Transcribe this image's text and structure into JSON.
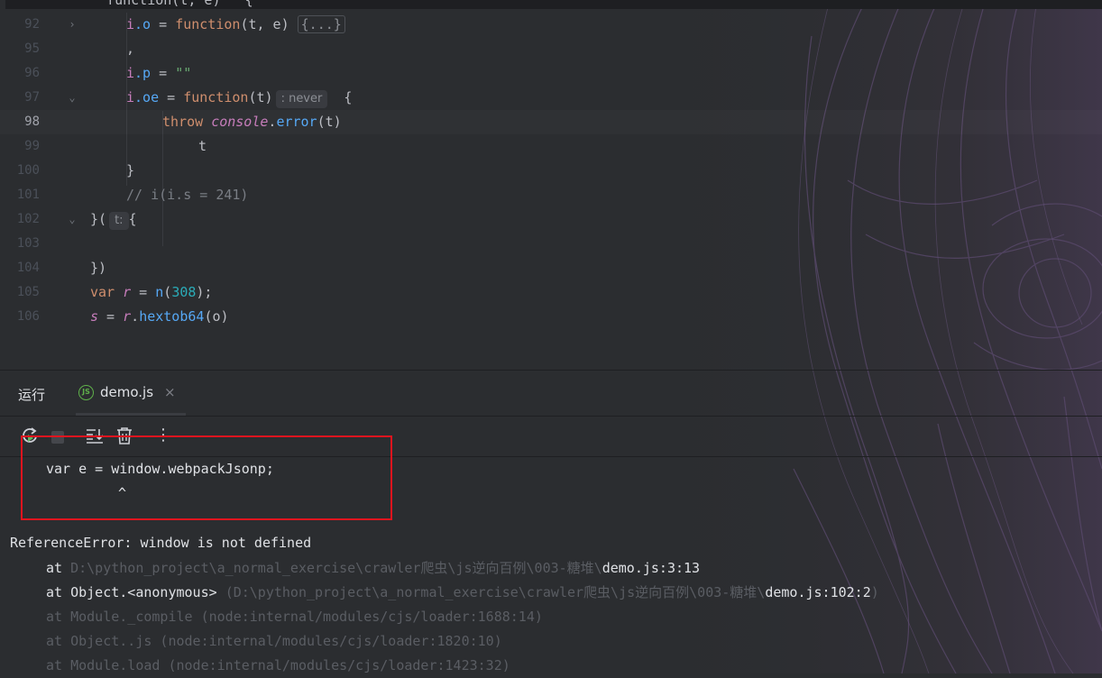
{
  "editor": {
    "top_partial_text": "  function(t, e)   {",
    "lines": [
      {
        "num": "92",
        "fold": "›",
        "code": [
          [
            "i",
            "prop"
          ],
          [
            ".o",
            "fn"
          ],
          [
            " = ",
            ""
          ],
          [
            "function",
            "kw"
          ],
          [
            "(t, e) ",
            ""
          ]
        ],
        "fold_box": "{...}"
      },
      {
        "num": "95",
        "code": [
          [
            ",",
            ""
          ]
        ]
      },
      {
        "num": "96",
        "code": [
          [
            "i",
            "prop"
          ],
          [
            ".p",
            "fn"
          ],
          [
            " = ",
            ""
          ],
          [
            "\"\"",
            "str"
          ]
        ]
      },
      {
        "num": "97",
        "fold": "⌄",
        "code": [
          [
            "i",
            "prop"
          ],
          [
            ".oe",
            "fn"
          ],
          [
            " = ",
            ""
          ],
          [
            "function",
            "kw"
          ],
          [
            "(t)",
            ""
          ]
        ],
        "hint": ": never",
        "after_hint": "  {"
      },
      {
        "num": "98",
        "current": true,
        "code": [
          [
            "throw ",
            "kw"
          ],
          [
            "console",
            "ital"
          ],
          [
            ".",
            ""
          ],
          [
            "error",
            "fn"
          ],
          [
            "(t)",
            ""
          ]
        ]
      },
      {
        "num": "99",
        "code": [
          [
            "t",
            ""
          ]
        ]
      },
      {
        "num": "100",
        "code": [
          [
            "}",
            ""
          ]
        ]
      },
      {
        "num": "101",
        "code": [
          [
            "// i(i.s = 241)",
            "cmt"
          ]
        ]
      },
      {
        "num": "102",
        "fold": "⌄",
        "code": [
          [
            "}(",
            ""
          ]
        ],
        "hint": "t:",
        "after_hint": "{"
      },
      {
        "num": "103",
        "code": []
      },
      {
        "num": "104",
        "code": [
          [
            "})",
            ""
          ]
        ]
      },
      {
        "num": "105",
        "code": [
          [
            "var ",
            "kw"
          ],
          [
            "r",
            "ital"
          ],
          [
            " = ",
            ""
          ],
          [
            "n",
            "fn"
          ],
          [
            "(",
            ""
          ],
          [
            "308",
            "num"
          ],
          [
            ");",
            ""
          ]
        ]
      },
      {
        "num": "106",
        "code": [
          [
            "s",
            "ital"
          ],
          [
            " = ",
            ""
          ],
          [
            "r",
            "ital"
          ],
          [
            ".",
            ""
          ],
          [
            "hextob64",
            "fn"
          ],
          [
            "(",
            ""
          ],
          [
            "o",
            ""
          ],
          [
            ")",
            ""
          ]
        ]
      }
    ]
  },
  "run": {
    "title": "运行",
    "tab_label": "demo.js",
    "tab_icon_text": "JS",
    "tab_close": "×",
    "toolbar_more": "⋮"
  },
  "console": {
    "code_line": "var e = window.webpackJsonp;",
    "caret": "^",
    "error": "ReferenceError: window is not defined",
    "frame1_at": "at ",
    "frame1_path": "D:\\python_project\\a_normal_exercise\\crawler爬虫\\js逆向百例\\003-糖堆\\",
    "frame1_file": "demo.js:3:13",
    "frame2_at": "at Object.<anonymous> ",
    "frame2_path": "(D:\\python_project\\a_normal_exercise\\crawler爬虫\\js逆向百例\\003-糖堆\\",
    "frame2_file": "demo.js:102:2",
    "frame2_close": ")",
    "frame3": "at Module._compile (node:internal/modules/cjs/loader:1688:14)",
    "frame4": "at Object..js (node:internal/modules/cjs/loader:1820:10)",
    "frame5": "at Module.load (node:internal/modules/cjs/loader:1423:32)"
  }
}
